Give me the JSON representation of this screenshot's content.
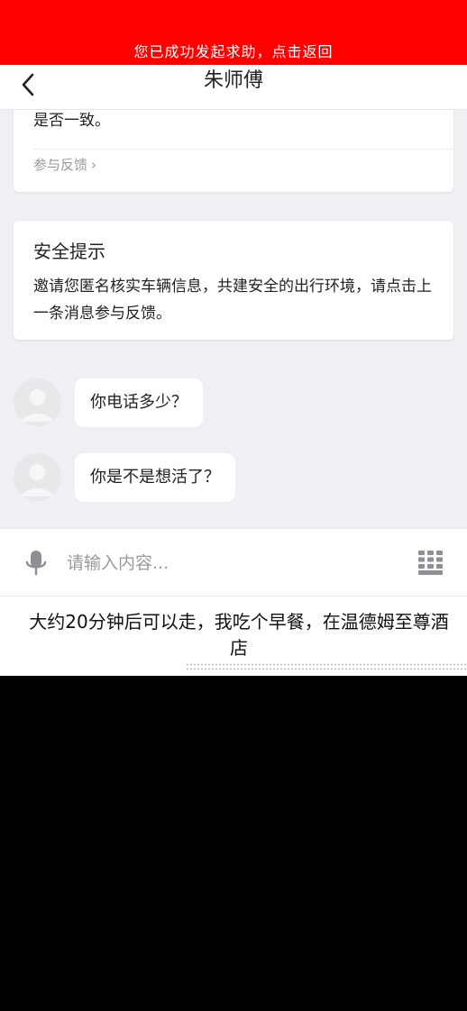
{
  "banner": {
    "text": "您已成功发起求助，点击返回",
    "color": "#ff0000"
  },
  "navbar": {
    "title": "朱师傅",
    "back_icon": "chevron-left-icon"
  },
  "chat": {
    "previous_card": {
      "text_end": "是否一致。",
      "feedback_label": "参与反馈"
    },
    "safety_card": {
      "title": "安全提示",
      "body": "邀请您匿名核实车辆信息，共建安全的出行环境，请点击上一条消息参与反馈。"
    },
    "messages": [
      {
        "text": "你电话多少？"
      },
      {
        "text": "你是不是想活了？"
      }
    ]
  },
  "input_bar": {
    "placeholder": "请输入内容...",
    "mic_icon": "microphone-icon",
    "keypad_icon": "keypad-icon"
  },
  "caption": {
    "text": "大约20分钟后可以走，我吃个早餐，在温德姆至尊酒店"
  }
}
